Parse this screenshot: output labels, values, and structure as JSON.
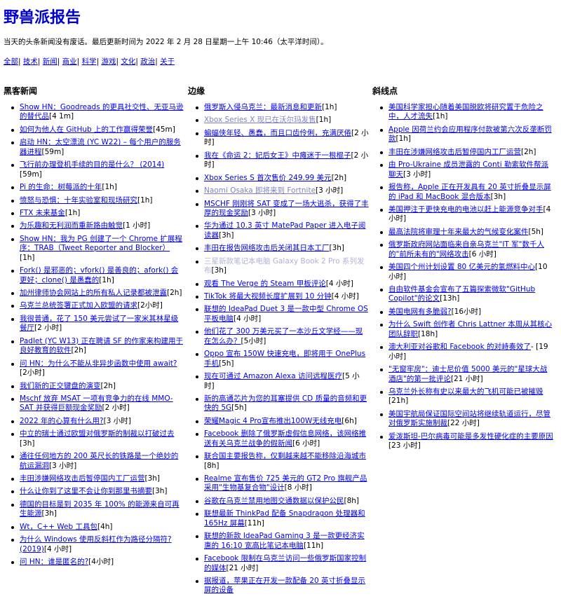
{
  "title": "野兽派报告",
  "subtitle": "当天的头条新闻没有废话。最后更新时间为 2022 年 2 月 28 日星期一上午 10:46（太平洋时间）。",
  "nav": [
    "全部",
    "技术",
    "新闻",
    "商业",
    "科学",
    "游戏",
    "文化",
    "政治",
    "关于"
  ],
  "columns": [
    {
      "heading": "黑客新闻",
      "items": [
        {
          "text": "Show HN：Goodreads 的更具社交性、无亚马逊的替代品",
          "age": "[4 1m]"
        },
        {
          "text": "如何为他人在 GitHub 上的工作赢得荣誉",
          "age": "[45m]"
        },
        {
          "text": "启动 HN：太空漂流 (YC W22) – 每个用户的服务器进程",
          "age": "[59m]"
        },
        {
          "text": "飞行前办理登机手续的目的是什么？ (2014)",
          "age": "[59m]"
        },
        {
          "text": "Pi 的生命：树莓派的十年",
          "age": "[1h]"
        },
        {
          "text": "愤怒与恐惧：十年实验室和现场研究",
          "age": "[1h]"
        },
        {
          "text": "FTX 未来基金",
          "age": "[1h]"
        },
        {
          "text": "为乐趣和无利润而重新路由触觉",
          "age": "[1 小时]"
        },
        {
          "text": "Show HN：我为 PG 创建了一个 Chrome 扩展程序：TRAB（Tweet Reporter and Blocker）",
          "age": "[1h]"
        },
        {
          "text": "Fork() 是邪恶的；vfork() 是善良的；afork() 会更好；clone() 是愚蠢的",
          "age": "[1h]"
        },
        {
          "text": "加州律师协会网站上的所有私人记录都被泄露",
          "age": "[2h]"
        },
        {
          "text": "乌克兰总统签署正式加入欧盟的请求",
          "age": "[2小时]"
        },
        {
          "text": "我很普通，花了 150 美元尝试了一家米其林星级餐厅",
          "age": "[2 小时]"
        },
        {
          "text": "Padlet (YC W13) 正在聘请 SF 的作家来构建用于良好教育的软件",
          "age": "[2h]"
        },
        {
          "text": "问 HN：为什么不能从非异步函数中使用 await?",
          "age": "[2小时]"
        },
        {
          "text": "我们新的正交键盘的演变",
          "age": "[2h]"
        },
        {
          "text": "Mschf 放弃 MSAT 一项有竞争力的在线 MMO-SAT 并获得巨额现金奖励",
          "age": "[2 小时]"
        },
        {
          "text": "2022 年的心算有什么用?",
          "age": "[3 小时]"
        },
        {
          "text": "中立的瑞士通过欧盟对俄罗斯的制裁以打破过去",
          "age": "[3h]"
        },
        {
          "text": "通往任何地方的 200 英尺长的铁路是一个绝妙的航运漏洞",
          "age": "[3 小时]"
        },
        {
          "text": "丰田涉嫌网络攻击后暂停国内工厂运营",
          "age": "[3h]"
        },
        {
          "text": "什么让你到了这里不会让你到那里书摘要",
          "age": "[3h]"
        },
        {
          "text": "德国的目标是到 2035 年 100% 的能源来自可再生能源",
          "age": "[3h]"
        },
        {
          "text": "Wt，C++ Web 工具包",
          "age": "[4h]"
        },
        {
          "text": "为什么 Windows 使用反斜杠作为路径分隔符? (2019)",
          "age": "[4 小时]"
        },
        {
          "text": "问 HN：谁是匿名的?",
          "age": "[4小时]"
        }
      ]
    },
    {
      "heading": "边缘",
      "items": [
        {
          "text": "俄罗斯入侵乌克兰：最新消息和更新",
          "age": "[1h]"
        },
        {
          "text": "Xbox Series X 现已在沃尔玛发售",
          "age": "[1h]",
          "style": "dim"
        },
        {
          "text": "蝙蝠侠年轻、愚蠢，而且口齿伶俐，充满厌倦",
          "age": "[2 小时]"
        },
        {
          "text": "我在《命运 2：妃后女王》中瘫迷于一根棍子",
          "age": "[2 小时]"
        },
        {
          "text": "Xbox Series S 首次售价 249.99 美元",
          "age": "[2h]"
        },
        {
          "text": "Naomi Osaka 即将来到 Fortnite",
          "age": "[3 小时]",
          "style": "dim"
        },
        {
          "text": "MSCHF 刚刚将 SAT 变成了一场大逃杀，获得了丰厚的现金奖励",
          "age": "[3 小时]"
        },
        {
          "text": "华为通过 10.3 英寸 MatePad Paper 进入电子阅读器",
          "age": "[3h]"
        },
        {
          "text": "丰田在报告网络攻击后关闭其日本工厂",
          "age": "[3h]"
        },
        {
          "text": "三星新款笔记本电脑 Galaxy Book 2 Pro 系列发布",
          "age": "[3h]",
          "style": "faint"
        },
        {
          "text": "观看 The Verge 的 Steam 甲板评论",
          "age": "[4 小时]"
        },
        {
          "text": "TikTok 将最大视频长度扩展到 10 分钟",
          "age": "[4 小时]"
        },
        {
          "text": "联想的 IdeaPad Duet 3 是一款中型 Chrome OS 平板电脑",
          "age": "[4 小时]"
        },
        {
          "text": "他们花了 300 万美元买了一本沙丘文学经——现在怎么办？",
          "age": "[5小时]"
        },
        {
          "text": "Oppo 宣布 150W 快速充电，即将用于 OnePlus 手机",
          "age": "[5h]"
        },
        {
          "text": "现在可通过 Amazon Alexa 访问远程医疗",
          "age": "[5 小时]"
        },
        {
          "text": "新的高通芯片为您的耳塞提供 CD 质量的音频和更快的 5G",
          "age": "[5h]"
        },
        {
          "text": "荣耀Magic 4 Pro宣布推出100W无线充电",
          "age": "[6h]"
        },
        {
          "text": "Facebook 删除了俄罗斯虚假信息网络，该网络推送有关乌克兰战争的假新闻",
          "age": "[6 小时]"
        },
        {
          "text": "联合国主要报告称，仅剩越来越不能移除沿海城市",
          "age": "[8h]"
        },
        {
          "text": "Realme 宣布售价 725 美元的 GT2 Pro 旗舰产品采用\"生物基复合物\"设计",
          "age": "[8 小时]"
        },
        {
          "text": "谷歌在乌克兰禁用地图交通数据以保护公民",
          "age": "[8h]"
        },
        {
          "text": "联想最新 ThinkPad 配备 Snapdragon 处理器和 165Hz 屏幕",
          "age": "[11h]"
        },
        {
          "text": "联想的新款 IdeaPad Gaming 3 是一款更经济实惠的 16:10 宽高比笔记本电脑",
          "age": "[11h]"
        },
        {
          "text": "Facebook 限制在乌克兰访问一些俄罗斯国家控制的媒体",
          "age": "[21 小时]"
        },
        {
          "text": "据报道，苹果正在开发一款配备 20 英寸折叠显示屏的设备",
          "age": ""
        }
      ]
    },
    {
      "heading": "斜线点",
      "items": [
        {
          "text": "美国科学家担心随着美国脱欧将研究置于危险之中，人才流失",
          "age": "[1h]"
        },
        {
          "text": "Apple 因荷兰约会应用程序付款被第六次反垄断罚款",
          "age": "[1h]"
        },
        {
          "text": "丰田在涉嫌网络攻击后暂停国内工厂运营",
          "age": "[2h]"
        },
        {
          "text": "由 Pro-Ukraine 成员泄露的 Conti 勒索软件帮派聊天",
          "age": "[3 小时]"
        },
        {
          "text": "报告称，Apple 正在开发具有 20 英寸折叠显示屏的 iPad 和 MacBook 混合版本",
          "age": "[3h]"
        },
        {
          "text": "美国押注于更快充电的电池以赶上能源竞争对手",
          "age": "[4 小时]"
        },
        {
          "text": "最高法院将审理十年来最大的气候变化案件",
          "age": "[5h]"
        },
        {
          "text": "俄罗斯政府网站面临来自亲乌克兰\"IT 军\"数千人的\"前所未有的\"网络攻击",
          "age": "[6 小时]"
        },
        {
          "text": "美国四个州计划设置 80 亿美元的氢燃料中心",
          "age": "[10 小时]"
        },
        {
          "text": "自由软件基金会宣布了五篇探索微软\"GitHub Copilot\"的论文",
          "age": "[13h]"
        },
        {
          "text": "美国电网有多脆弱?",
          "age": "[16小时]"
        },
        {
          "text": "为什么 Swift 创作者 Chris Lattner 本周从其核心团队辞职",
          "age": "[18h]"
        },
        {
          "text": "澳大利亚对谷歌和 Facebook 的对峙奏效了",
          "age": "- [19 小时]"
        },
        {
          "text": "\"无窗牢房\"：迪士尼价值 5000 美元的\"星球大战酒店\"的第一批评论",
          "age": "[21 小时]"
        },
        {
          "text": "乌克兰外长称有史以来最大的飞机可能已被摧毁",
          "age": "[21h]"
        },
        {
          "text": "美国宇航局保证国际空间站将继续轨道运行，尽管对俄罗斯实施制裁",
          "age": "[22 小时]"
        },
        {
          "text": "爱泼斯坦-巴尔病毒可能是多发性硬化症的主要原因",
          "age": "[23 小时]"
        }
      ]
    }
  ]
}
